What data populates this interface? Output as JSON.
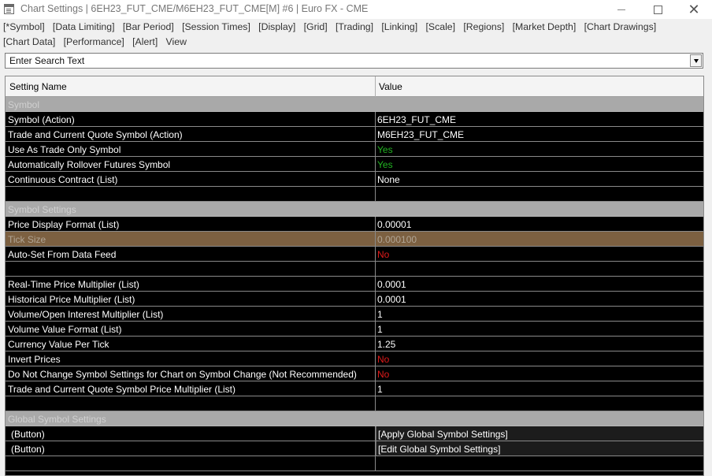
{
  "window": {
    "title": "Chart Settings | 6EH23_FUT_CME/M6EH23_FUT_CME[M]  #6 | Euro FX - CME",
    "icons": {
      "app": "app-window-icon",
      "minimize": "minimize-icon",
      "maximize": "maximize-icon",
      "close": "close-icon"
    },
    "close_glyph": "✕"
  },
  "tabs": {
    "row1": [
      "[*Symbol]",
      "[Data Limiting]",
      "[Bar Period]",
      "[Session Times]",
      "[Display]",
      "[Grid]",
      "[Trading]",
      "[Linking]",
      "[Scale]",
      "[Regions]",
      "[Market Depth]",
      "[Chart Drawings]"
    ],
    "row2": [
      "[Chart Data]",
      "[Performance]",
      "[Alert]",
      "View"
    ]
  },
  "search": {
    "text": "Enter Search Text",
    "dropdown_icon": "chevron-down-icon"
  },
  "grid": {
    "header": {
      "name": "Setting Name",
      "value": "Value"
    },
    "rows": [
      {
        "type": "group",
        "name": "Symbol",
        "value": ""
      },
      {
        "type": "row",
        "name": "Symbol (Action)",
        "value": "6EH23_FUT_CME"
      },
      {
        "type": "row",
        "name": "Trade and Current Quote Symbol (Action)",
        "value": "M6EH23_FUT_CME"
      },
      {
        "type": "row",
        "name": "Use As Trade Only Symbol",
        "value": "Yes",
        "status": "yes"
      },
      {
        "type": "row",
        "name": "Automatically Rollover Futures Symbol",
        "value": "Yes",
        "status": "yes"
      },
      {
        "type": "row",
        "name": "Continuous Contract (List)",
        "value": "None"
      },
      {
        "type": "blank",
        "name": "",
        "value": ""
      },
      {
        "type": "group",
        "name": "Symbol Settings",
        "value": ""
      },
      {
        "type": "row",
        "name": "Price Display Format (List)",
        "value": "0.00001"
      },
      {
        "type": "sel",
        "name": "Tick Size",
        "value": "0.000100"
      },
      {
        "type": "row",
        "name": "Auto-Set From Data Feed",
        "value": "No",
        "status": "no"
      },
      {
        "type": "blank",
        "name": "",
        "value": ""
      },
      {
        "type": "row",
        "name": "Real-Time Price Multiplier (List)",
        "value": "0.0001"
      },
      {
        "type": "row",
        "name": "Historical Price Multiplier (List)",
        "value": "0.0001"
      },
      {
        "type": "row",
        "name": "Volume/Open Interest Multiplier (List)",
        "value": "1"
      },
      {
        "type": "row",
        "name": "Volume Value Format (List)",
        "value": "1"
      },
      {
        "type": "row",
        "name": "Currency Value Per Tick",
        "value": "1.25"
      },
      {
        "type": "row",
        "name": "Invert Prices",
        "value": "No",
        "status": "no"
      },
      {
        "type": "row",
        "name": "Do Not Change Symbol Settings for Chart on Symbol Change (Not Recommended)",
        "value": "No",
        "status": "no"
      },
      {
        "type": "row",
        "name": "Trade and Current Quote Symbol Price Multiplier (List)",
        "value": "1"
      },
      {
        "type": "blank",
        "name": "",
        "value": ""
      },
      {
        "type": "group",
        "name": "Global Symbol Settings",
        "value": ""
      },
      {
        "type": "btn",
        "name": "(Button)",
        "value": "[Apply Global Symbol Settings]"
      },
      {
        "type": "btn",
        "name": "(Button)",
        "value": "[Edit Global Symbol Settings]"
      },
      {
        "type": "blank",
        "name": "",
        "value": ""
      }
    ]
  },
  "colors": {
    "yes": "#22b422",
    "no": "#e01a1a",
    "selected_row": "#7c6041",
    "group_row": "#a9a9a9",
    "grid_background": "#000000"
  }
}
